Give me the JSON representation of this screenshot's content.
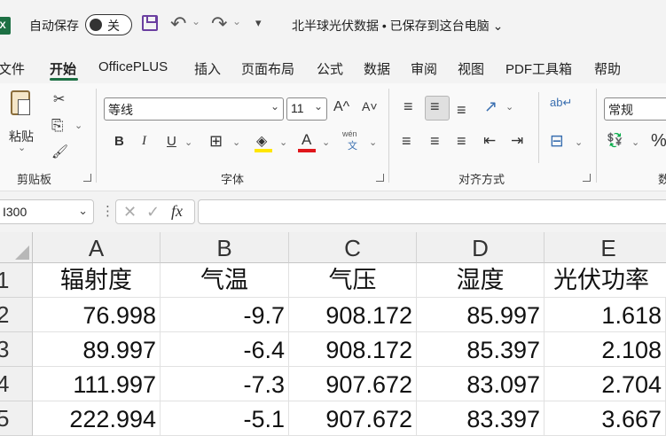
{
  "titlebar": {
    "logo": "X",
    "autosave_label": "自动保存",
    "toggle_label": "关",
    "undo_glyph": "↶",
    "redo_glyph": "↷",
    "caret": "⌄",
    "customize_glyph": "▾",
    "doc_title": "北半球光伏数据 • 已保存到这台电脑 ⌄"
  },
  "menu": {
    "items": [
      "文件",
      "开始",
      "OfficePLUS",
      "插入",
      "页面布局",
      "公式",
      "数据",
      "审阅",
      "视图",
      "PDF工具箱",
      "帮助"
    ],
    "active_index": 1
  },
  "ribbon": {
    "clipboard": {
      "paste_label": "粘贴",
      "paste_caret": "⌄",
      "cut_icon": "✂",
      "copy_icon": "⎘",
      "format_painter_icon": "🖌",
      "group_label": "剪贴板"
    },
    "font": {
      "font_name": "等线",
      "font_size": "11",
      "grow_label": "A^",
      "shrink_label": "A˅",
      "bold": "B",
      "italic": "I",
      "underline": "U",
      "border_icon": "⊞",
      "fill_icon": "◈",
      "color_label": "A",
      "phonetic_top": "wén",
      "phonetic_bottom": "文",
      "group_label": "字体",
      "colors": {
        "fill": "#ffe600",
        "font": "#e0161b"
      }
    },
    "alignment": {
      "top_align": "≡",
      "middle_align": "≡",
      "bottom_align": "≡",
      "orientation_icon": "↗",
      "left_align": "≡",
      "center_align": "≡",
      "right_align": "≡",
      "decrease_indent": "⇤",
      "increase_indent": "⇥",
      "wrap_label": "ab↵",
      "merge_icon": "⊟",
      "group_label": "对齐方式"
    },
    "number": {
      "format": "常规",
      "currency_icon": "💱",
      "percent": "%",
      "group_label": "数"
    }
  },
  "formula_bar": {
    "name_box": "I300",
    "cancel_glyph": "✕",
    "enter_glyph": "✓",
    "fx_label": "fx",
    "value": ""
  },
  "sheet": {
    "columns": [
      "A",
      "B",
      "C",
      "D",
      "E"
    ],
    "rows": [
      {
        "num": "1",
        "cells": [
          "辐射度",
          "气温",
          "气压",
          "湿度",
          "光伏功率"
        ]
      },
      {
        "num": "2",
        "cells": [
          "76.998",
          "-9.7",
          "908.172",
          "85.997",
          "1.618"
        ]
      },
      {
        "num": "3",
        "cells": [
          "89.997",
          "-6.4",
          "908.172",
          "85.397",
          "2.108"
        ]
      },
      {
        "num": "4",
        "cells": [
          "111.997",
          "-7.3",
          "907.672",
          "83.097",
          "2.704"
        ]
      },
      {
        "num": "5",
        "cells": [
          "222.994",
          "-5.1",
          "907.672",
          "83.397",
          "3.667"
        ]
      }
    ]
  }
}
